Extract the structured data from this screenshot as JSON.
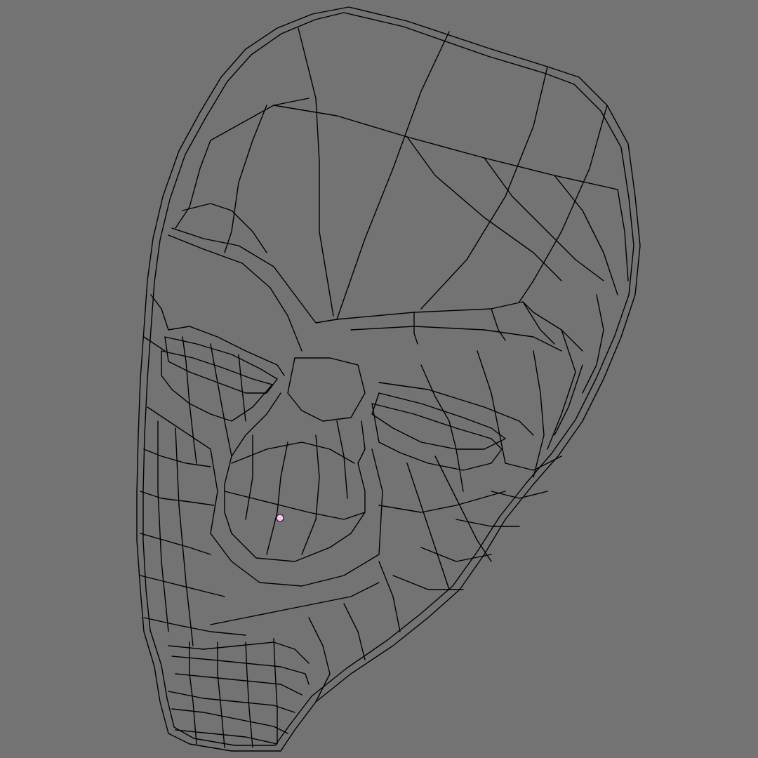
{
  "viewport": {
    "background_color": "#737373",
    "wire_color": "#000000",
    "vertex_color": "#f2c8ec"
  },
  "mesh": {
    "object": "head-mask",
    "display": "wireframe",
    "selected_vertices": 1
  }
}
